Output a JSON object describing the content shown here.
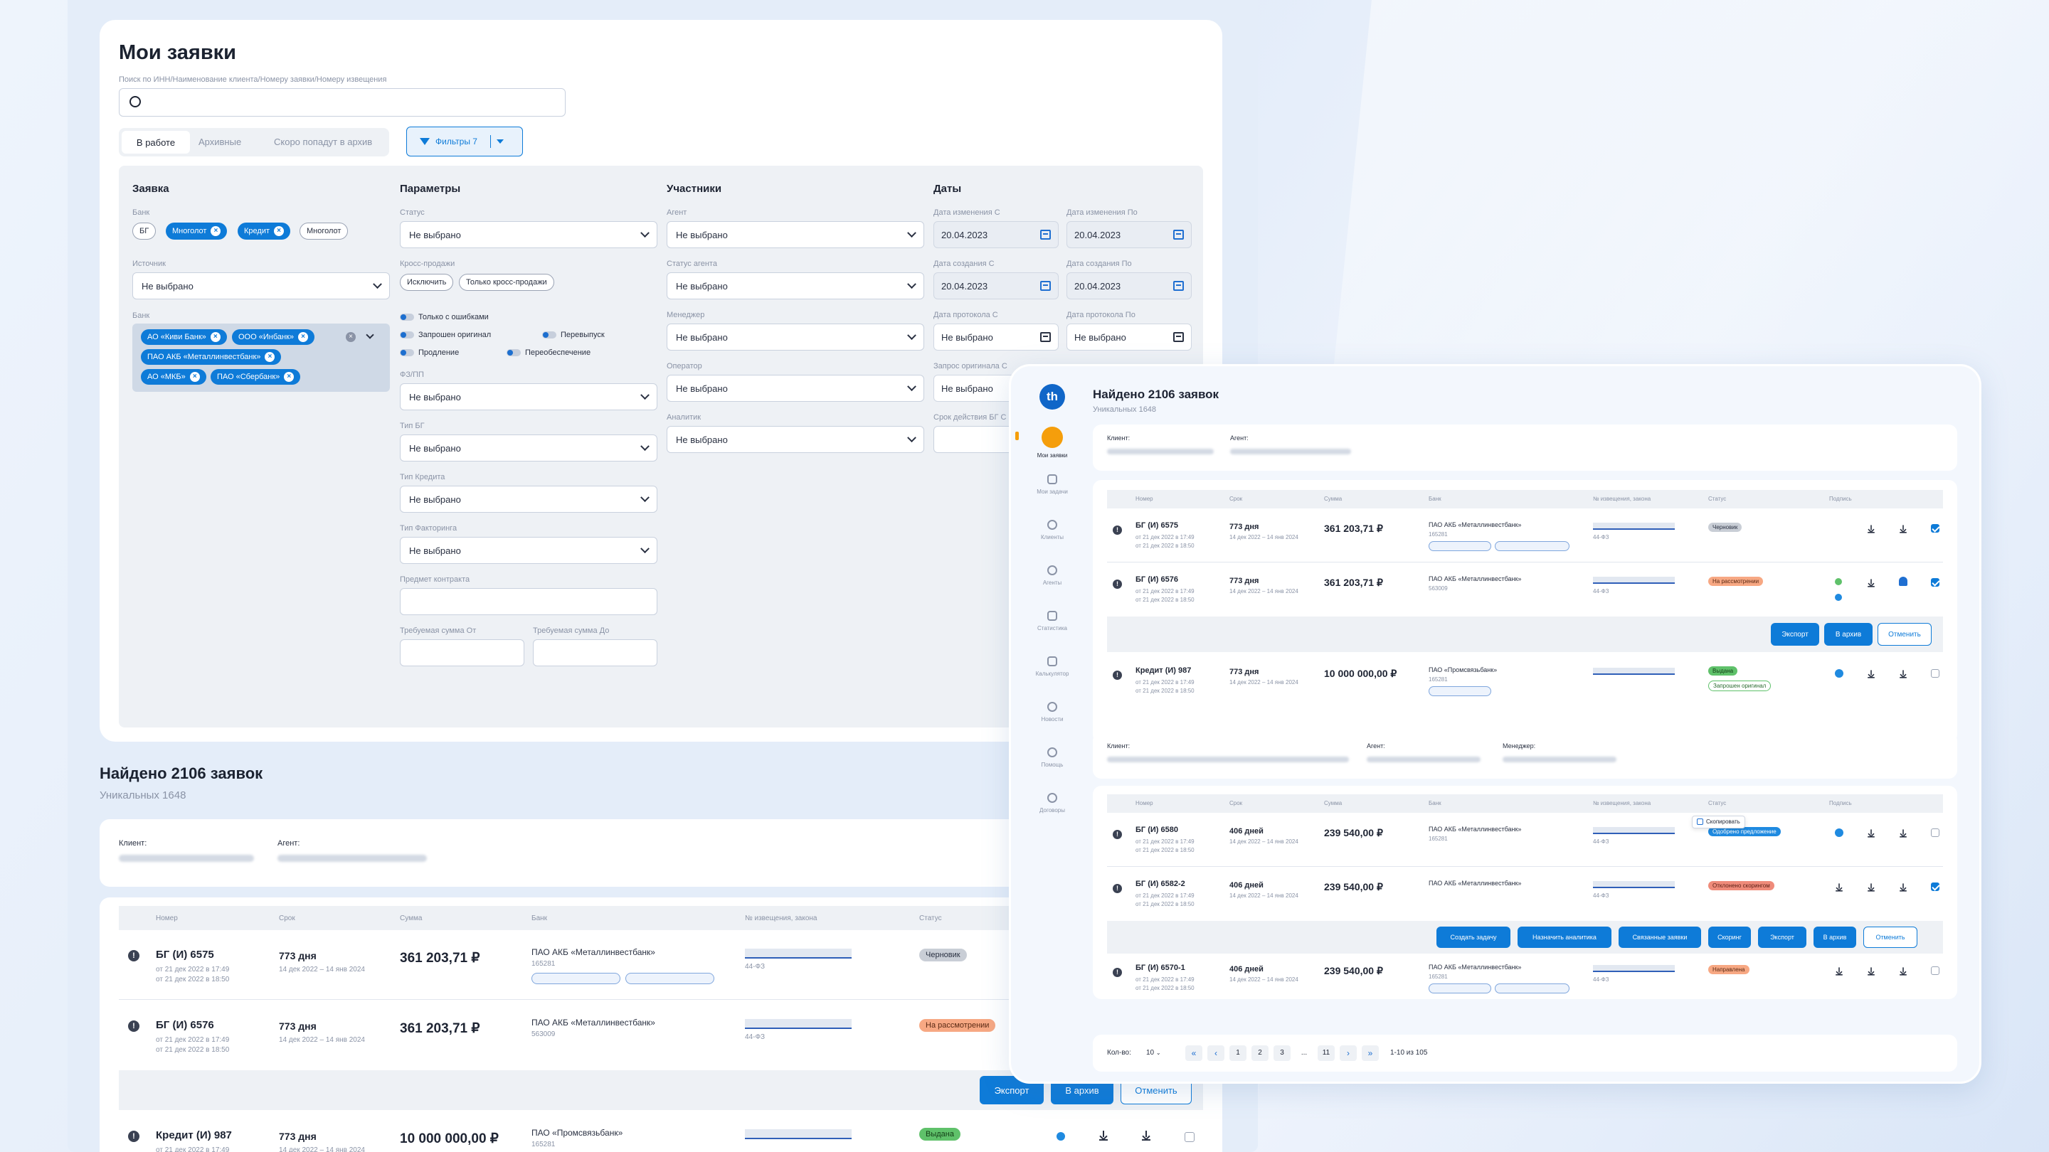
{
  "main": {
    "title": "Мои заявки",
    "search_label": "Поиск по ИНН/Наименование клиента/Номеру заявки/Номеру извещения",
    "tabs": [
      "В работе",
      "Архивные",
      "Скоро попадут в архив"
    ],
    "filters_button": "Фильтры 7",
    "sections": {
      "zayavka": "Заявка",
      "params": "Параметры",
      "members": "Участники",
      "dates": "Даты"
    },
    "zayavka": {
      "bank_label": "Банк",
      "bank_chips": [
        "БГ",
        "Многолот",
        "Кредит",
        "Многолот"
      ],
      "source_label": "Источник",
      "source_value": "Не выбрано",
      "bank2_label": "Банк",
      "bank2_chips": [
        "АО «Киви Банк»",
        "ООО «Инбанк»",
        "ПАО АКБ «Металлинвестбанк»",
        "АО «МКБ»",
        "ПАО «Сбербанк»"
      ]
    },
    "params": {
      "status_label": "Статус",
      "status_value": "Не выбрано",
      "cross_label": "Кросс-продажи",
      "cross_chips": [
        "Исключить",
        "Только кросс-продажи"
      ],
      "toggles": [
        "Только с ошибками",
        "Запрошен оригинал",
        "Перевыпуск",
        "Продление",
        "Переобеспечение"
      ],
      "fz_label": "ФЗ/ПП",
      "fz_value": "Не выбрано",
      "bg_type_label": "Тип БГ",
      "bg_type_value": "Не выбрано",
      "credit_type_label": "Тип Кредита",
      "credit_type_value": "Не выбрано",
      "factoring_label": "Тип Факторинга",
      "factoring_value": "Не выбрано",
      "subject_label": "Предмет контракта",
      "sum_from_label": "Требуемая сумма От",
      "sum_to_label": "Требуемая сумма До"
    },
    "members": {
      "agent_label": "Агент",
      "agent_value": "Не выбрано",
      "agent_status_label": "Статус агента",
      "agent_status_value": "Не выбрано",
      "manager_label": "Менеджер",
      "manager_value": "Не выбрано",
      "operator_label": "Оператор",
      "operator_value": "Не выбрано",
      "analyst_label": "Аналитик",
      "analyst_value": "Не выбрано"
    },
    "dates": {
      "change_from_label": "Дата изменения С",
      "change_from": "20.04.2023",
      "change_to_label": "Дата изменения По",
      "change_to": "20.04.2023",
      "create_from_label": "Дата создания С",
      "create_from": "20.04.2023",
      "create_to_label": "Дата создания По",
      "create_to": "20.04.2023",
      "protocol_from_label": "Дата протокола С",
      "protocol_from": "Не выбрано",
      "protocol_to_label": "Дата протокола По",
      "protocol_to": "Не выбрано",
      "orig_label": "Запрос оригинала С",
      "orig_value": "Не выбрано",
      "term_label": "Срок действия БГ С"
    },
    "found_title": "Найдено 2106 заявок",
    "unique": "Уникальных 1648",
    "client_label": "Клиент:",
    "agent_label": "Агент:",
    "table_headers": [
      "Номер",
      "Срок",
      "Сумма",
      "Банк",
      "№ извещения, закона",
      "Статус"
    ],
    "rows": [
      {
        "num": "БГ (И) 6575",
        "d1": "от 21 дек 2022 в 17:49",
        "d2": "от 21 дек 2022 в 18:50",
        "term": "773 дня",
        "period": "14 дек 2022 – 14 янв 2024",
        "sum": "361 203,71 ₽",
        "bank": "ПАО АКБ «Металлинвестбанк»",
        "inn": "165281",
        "law": "44-ФЗ",
        "status": "Черновик"
      },
      {
        "num": "БГ (И) 6576",
        "d1": "от 21 дек 2022 в 17:49",
        "d2": "от 21 дек 2022 в 18:50",
        "term": "773 дня",
        "period": "14 дек 2022 – 14 янв 2024",
        "sum": "361 203,71 ₽",
        "bank": "ПАО АКБ «Металлинвестбанк»",
        "inn": "563009",
        "law": "44-ФЗ",
        "status": "На рассмотрении"
      },
      {
        "num": "Кредит (И) 987",
        "d1": "от 21 дек 2022 в 17:49",
        "term": "773 дня",
        "period": "14 дек 2022 – 14 янв 2024",
        "sum": "10 000 000,00 ₽",
        "bank": "ПАО «Промсвязьбанк»",
        "inn": "165281",
        "status": "Выдана"
      }
    ],
    "actions": [
      "Экспорт",
      "В архив",
      "Отменить"
    ]
  },
  "panel": {
    "logo": "th",
    "nav": [
      "Мои заявки",
      "Мои задачи",
      "Клиенты",
      "Агенты",
      "Статистика",
      "Калькулятор",
      "Новости",
      "Помощь",
      "Договоры"
    ],
    "found_title": "Найдено 2106 заявок",
    "unique": "Уникальных 1648",
    "client_label": "Клиент:",
    "agent_label": "Агент:",
    "manager_label": "Менеджер:",
    "headers": [
      "Номер",
      "Срок",
      "Сумма",
      "Банк",
      "№ извещения, закона",
      "Статус",
      "Подпись"
    ],
    "group1": [
      {
        "num": "БГ (И) 6575",
        "d1": "от 21 дек 2022 в 17:49",
        "d2": "от 21 дек 2022 в 18:50",
        "term": "773 дня",
        "period": "14 дек 2022 – 14 янв 2024",
        "sum": "361 203,71 ₽",
        "bank": "ПАО АКБ «Металлинвестбанк»",
        "inn": "165281",
        "law": "44-ФЗ",
        "status": "Черновик"
      },
      {
        "num": "БГ (И) 6576",
        "d1": "от 21 дек 2022 в 17:49",
        "d2": "от 21 дек 2022 в 18:50",
        "term": "773 дня",
        "period": "14 дек 2022 – 14 янв 2024",
        "sum": "361 203,71 ₽",
        "bank": "ПАО АКБ «Металлинвестбанк»",
        "inn": "563009",
        "law": "44-ФЗ",
        "status": "На рассмотрении"
      },
      {
        "num": "Кредит (И) 987",
        "d1": "от 21 дек 2022 в 17:49",
        "d2": "от 21 дек 2022 в 18:50",
        "term": "773 дня",
        "period": "14 дек 2022 – 14 янв 2024",
        "sum": "10 000 000,00 ₽",
        "bank": "ПАО «Промсвязьбанк»",
        "inn": "165281",
        "status": "Выдана",
        "status2": "Запрошен оригинал"
      }
    ],
    "group1_actions": [
      "Экспорт",
      "В архив",
      "Отменить"
    ],
    "group2": [
      {
        "num": "БГ (И) 6580",
        "d1": "от 21 дек 2022 в 17:49",
        "d2": "от 21 дек 2022 в 18:50",
        "term": "406 дней",
        "period": "14 дек 2022 – 14 янв 2024",
        "sum": "239 540,00 ₽",
        "bank": "ПАО АКБ «Металлинвестбанк»",
        "inn": "165281",
        "law": "44-ФЗ",
        "status": "Одобрено предложение"
      },
      {
        "num": "БГ (И) 6582-2",
        "d1": "от 21 дек 2022 в 17:49",
        "d2": "от 21 дек 2022 в 18:50",
        "term": "406 дней",
        "period": "14 дек 2022 – 14 янв 2024",
        "sum": "239 540,00 ₽",
        "bank": "ПАО АКБ «Металлинвестбанк»",
        "law": "44-ФЗ",
        "status": "Отклонено скорингом"
      },
      {
        "num": "БГ (И) 6570-1",
        "d1": "от 21 дек 2022 в 17:49",
        "d2": "от 21 дек 2022 в 18:50",
        "term": "406 дней",
        "period": "14 дек 2022 – 14 янв 2024",
        "sum": "239 540,00 ₽",
        "bank": "ПАО АКБ «Металлинвестбанк»",
        "inn": "165281",
        "law": "44-ФЗ",
        "status": "Направлена"
      }
    ],
    "copy_tooltip": "Скопировать",
    "group2_actions": [
      "Создать задачу",
      "Назначить аналитика",
      "Связанные заявки",
      "Скоринг",
      "Экспорт",
      "В архив",
      "Отменить"
    ],
    "per_page_label": "Кол-во:",
    "per_page": "10",
    "pages": [
      "«",
      "‹",
      "1",
      "2",
      "3",
      "...",
      "11",
      "›",
      "»"
    ],
    "range": "1-10 из 105"
  },
  "colors": {
    "accent": "#0e7bd8",
    "bg": "#e4edf9",
    "nav_active": "#f59e0b"
  }
}
